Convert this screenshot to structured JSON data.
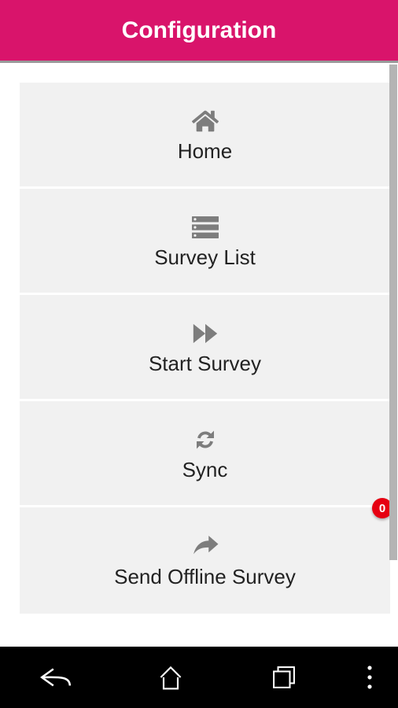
{
  "header": {
    "title": "Configuration"
  },
  "menu": [
    {
      "id": "home",
      "label": "Home",
      "icon": "home-icon"
    },
    {
      "id": "survey-list",
      "label": "Survey List",
      "icon": "list-icon"
    },
    {
      "id": "start-survey",
      "label": "Start Survey",
      "icon": "fast-forward-icon"
    },
    {
      "id": "sync",
      "label": "Sync",
      "icon": "sync-icon"
    },
    {
      "id": "send-offline",
      "label": "Send Offline Survey",
      "icon": "share-icon",
      "badge": "0"
    }
  ],
  "colors": {
    "accent": "#d9146b",
    "badge": "#e60012"
  }
}
